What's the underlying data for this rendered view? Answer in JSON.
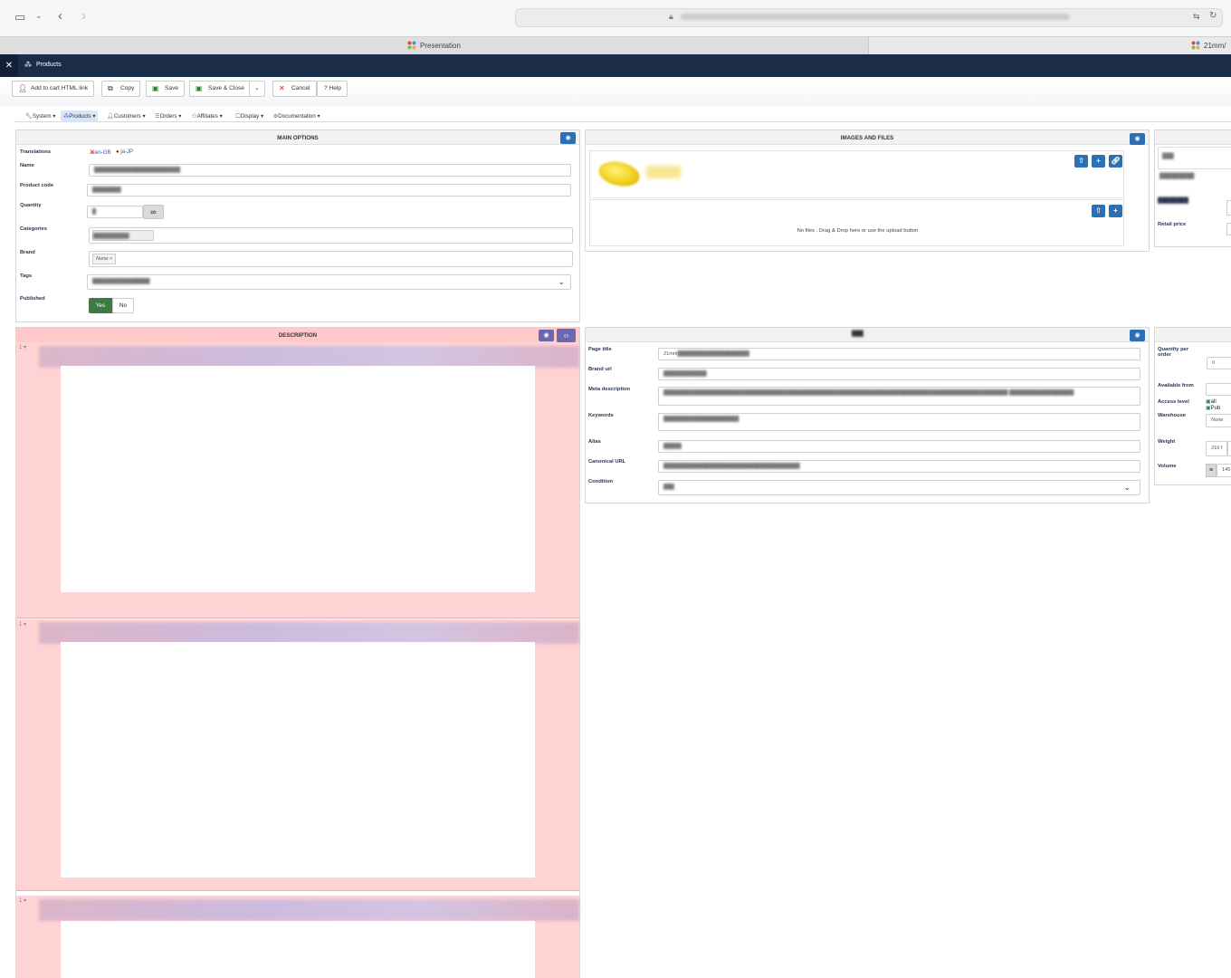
{
  "browser": {
    "tabs": [
      {
        "label": "Presentation"
      },
      {
        "label": "21mm/"
      }
    ]
  },
  "header": {
    "title": "Products"
  },
  "toolbar": {
    "add_to_cart": "Add to cart HTML link",
    "copy": "Copy",
    "save": "Save",
    "save_close": "Save & Close",
    "cancel": "Cancel",
    "help": "Help"
  },
  "submenu": {
    "system": "System",
    "products": "Products",
    "customers": "Customers",
    "orders": "Orders",
    "affiliates": "Affiliates",
    "display": "Display",
    "documentation": "Documentation"
  },
  "main_options": {
    "title": "MAIN OPTIONS",
    "translations_label": "Translations",
    "lang_en": "en-GB",
    "lang_ja": "ja-JP",
    "name_label": "Name",
    "product_code_label": "Product code",
    "quantity_label": "Quantity",
    "categories_label": "Categories",
    "brand_label": "Brand",
    "brand_value": "None",
    "tags_label": "Tags",
    "published_label": "Published",
    "yes": "Yes",
    "no": "No"
  },
  "images": {
    "title": "IMAGES AND FILES",
    "no_files": "No files . Drag & Drop here or use the upload button"
  },
  "price": {
    "retail_price_label": "Retail price"
  },
  "description": {
    "title": "DESCRIPTION"
  },
  "seo": {
    "page_title_label": "Page title",
    "page_title_value": "21mm",
    "brand_url_label": "Brand url",
    "meta_description_label": "Meta description",
    "keywords_label": "Keywords",
    "alias_label": "Alias",
    "canonical_label": "Canonical URL",
    "condition_label": "Condition"
  },
  "specs": {
    "quantity_per_order_label": "Quantity per order",
    "quantity_per_order_value": "0",
    "available_from_label": "Available from",
    "access_level_label": "Access level",
    "access_all": "all",
    "access_public": "Pub",
    "warehouse_label": "Warehouse",
    "warehouse_value": "None",
    "weight_label": "Weight",
    "weight_value": "216 f",
    "volume_label": "Volume",
    "volume_value": "145"
  },
  "colors": {
    "header_bg": "#1b2c48",
    "accent": "#2b6fb5",
    "published_green": "#3d7a46",
    "editor_bg": "#ffd3d3"
  }
}
